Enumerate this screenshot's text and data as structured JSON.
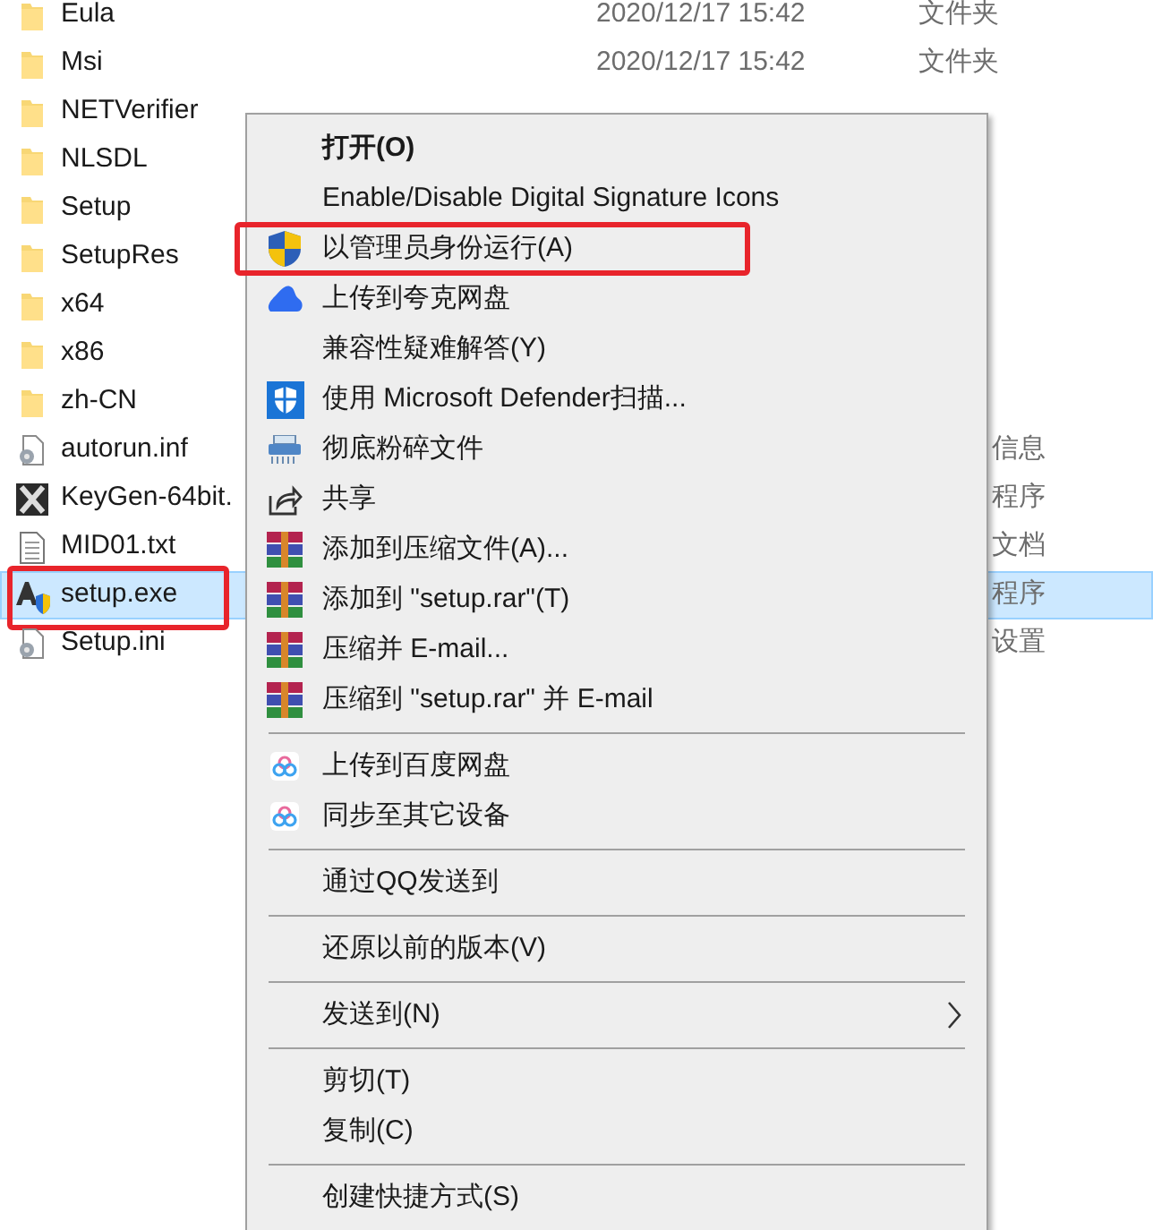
{
  "files": [
    {
      "name": "Eula",
      "kind": "folder",
      "date": "2020/12/17 15:42",
      "type": "文件夹",
      "selected": false,
      "highlighted": false
    },
    {
      "name": "Msi",
      "kind": "folder",
      "date": "2020/12/17 15:42",
      "type": "文件夹",
      "selected": false,
      "highlighted": false
    },
    {
      "name": "NETVerifier",
      "kind": "folder",
      "selected": false,
      "highlighted": false
    },
    {
      "name": "NLSDL",
      "kind": "folder",
      "selected": false,
      "highlighted": false
    },
    {
      "name": "Setup",
      "kind": "folder",
      "selected": false,
      "highlighted": false
    },
    {
      "name": "SetupRes",
      "kind": "folder",
      "selected": false,
      "highlighted": false
    },
    {
      "name": "x64",
      "kind": "folder",
      "selected": false,
      "highlighted": false
    },
    {
      "name": "x86",
      "kind": "folder",
      "selected": false,
      "highlighted": false
    },
    {
      "name": "zh-CN",
      "kind": "folder",
      "selected": false,
      "highlighted": false
    },
    {
      "name": "autorun.inf",
      "kind": "config",
      "type_tail": "信息",
      "selected": false,
      "highlighted": false
    },
    {
      "name": "KeyGen-64bit.",
      "kind": "app",
      "type_tail": "程序",
      "selected": false,
      "highlighted": false
    },
    {
      "name": "MID01.txt",
      "kind": "text",
      "type_tail": "文档",
      "selected": false,
      "highlighted": false
    },
    {
      "name": "setup.exe",
      "kind": "installer",
      "type_tail": "程序",
      "selected": true,
      "highlighted": true
    },
    {
      "name": "Setup.ini",
      "kind": "config",
      "type_tail": "设置",
      "selected": false,
      "highlighted": false
    }
  ],
  "context_menu": {
    "items": [
      {
        "kind": "plain",
        "label": "打开(O)",
        "default": true,
        "highlighted": false
      },
      {
        "kind": "plain",
        "label": "Enable/Disable Digital Signature Icons",
        "default": false,
        "highlighted": false
      },
      {
        "kind": "uac",
        "label": "以管理员身份运行(A)",
        "default": false,
        "highlighted": true
      },
      {
        "kind": "quark",
        "label": "上传到夸克网盘",
        "default": false,
        "highlighted": false
      },
      {
        "kind": "plain",
        "label": "兼容性疑难解答(Y)",
        "default": false,
        "highlighted": false
      },
      {
        "kind": "defender",
        "label": "使用 Microsoft Defender扫描...",
        "default": false,
        "highlighted": false
      },
      {
        "kind": "shred",
        "label": "彻底粉碎文件",
        "default": false,
        "highlighted": false
      },
      {
        "kind": "share",
        "label": "共享",
        "default": false,
        "highlighted": false
      },
      {
        "kind": "rar",
        "label": "添加到压缩文件(A)...",
        "default": false,
        "highlighted": false
      },
      {
        "kind": "rar",
        "label": "添加到 \"setup.rar\"(T)",
        "default": false,
        "highlighted": false
      },
      {
        "kind": "rar",
        "label": "压缩并 E-mail...",
        "default": false,
        "highlighted": false
      },
      {
        "kind": "rar",
        "label": "压缩到 \"setup.rar\" 并 E-mail",
        "default": false,
        "highlighted": false
      },
      {
        "kind": "separator"
      },
      {
        "kind": "baidu",
        "label": "上传到百度网盘",
        "default": false,
        "highlighted": false
      },
      {
        "kind": "baidu",
        "label": "同步至其它设备",
        "default": false,
        "highlighted": false
      },
      {
        "kind": "separator"
      },
      {
        "kind": "plain",
        "label": "通过QQ发送到",
        "default": false,
        "highlighted": false
      },
      {
        "kind": "separator"
      },
      {
        "kind": "plain",
        "label": "还原以前的版本(V)",
        "default": false,
        "highlighted": false
      },
      {
        "kind": "separator"
      },
      {
        "kind": "submenu",
        "label": "发送到(N)",
        "default": false,
        "highlighted": false
      },
      {
        "kind": "separator"
      },
      {
        "kind": "plain",
        "label": "剪切(T)",
        "default": false,
        "highlighted": false
      },
      {
        "kind": "plain",
        "label": "复制(C)",
        "default": false,
        "highlighted": false
      },
      {
        "kind": "separator"
      },
      {
        "kind": "plain",
        "label": "创建快捷方式(S)",
        "default": false,
        "highlighted": false
      }
    ]
  }
}
